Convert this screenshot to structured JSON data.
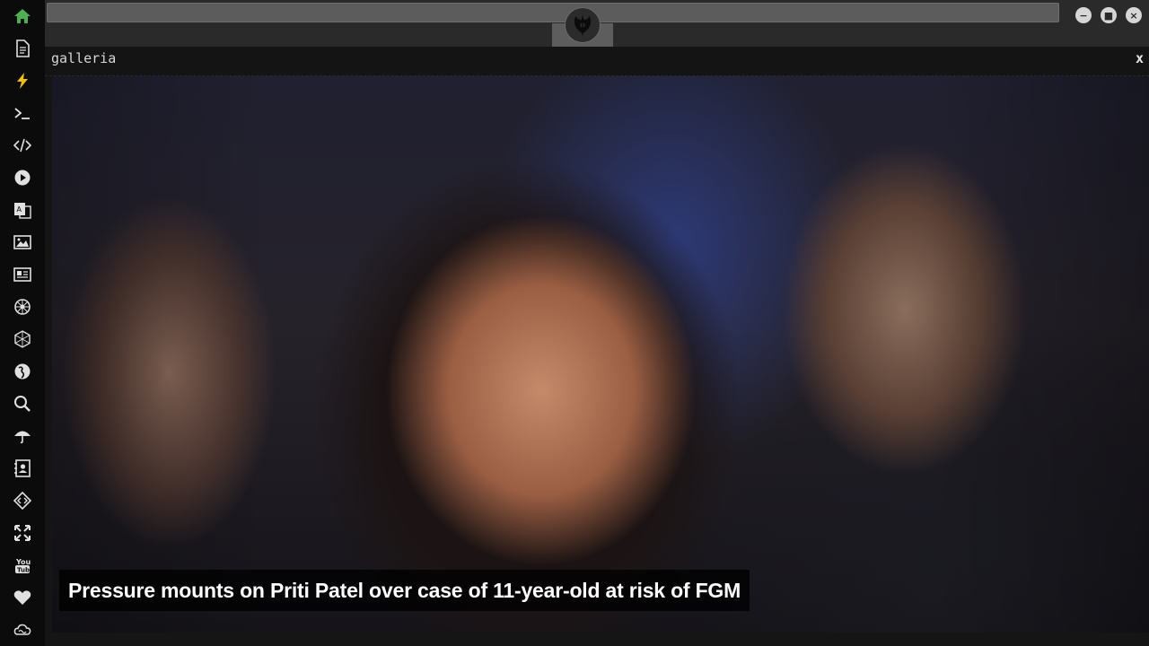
{
  "app": {
    "rebel_icon": "rebel-alliance-icon"
  },
  "dock": {
    "items": [
      {
        "name": "home",
        "icon": "home-icon",
        "color": "#4caf50"
      },
      {
        "name": "document",
        "icon": "document-icon",
        "color": "#e0e0e0"
      },
      {
        "name": "bolt",
        "icon": "bolt-icon",
        "color": "#f2c200"
      },
      {
        "name": "terminal",
        "icon": "terminal-icon",
        "color": "#e0e0e0"
      },
      {
        "name": "code",
        "icon": "code-icon",
        "color": "#e0e0e0"
      },
      {
        "name": "play",
        "icon": "play-icon",
        "color": "#e0e0e0"
      },
      {
        "name": "translate",
        "icon": "translate-icon",
        "color": "#e0e0e0"
      },
      {
        "name": "image",
        "icon": "image-icon",
        "color": "#e0e0e0"
      },
      {
        "name": "news",
        "icon": "newspaper-icon",
        "color": "#e0e0e0"
      },
      {
        "name": "network",
        "icon": "network-icon",
        "color": "#e0e0e0"
      },
      {
        "name": "cube",
        "icon": "hex-grid-icon",
        "color": "#e0e0e0"
      },
      {
        "name": "globe",
        "icon": "globe-icon",
        "color": "#e0e0e0"
      },
      {
        "name": "search",
        "icon": "search-icon",
        "color": "#e0e0e0"
      },
      {
        "name": "umbrella",
        "icon": "umbrella-icon",
        "color": "#e0e0e0"
      },
      {
        "name": "contacts",
        "icon": "contacts-icon",
        "color": "#e0e0e0"
      },
      {
        "name": "dev",
        "icon": "dev-icon",
        "color": "#e0e0e0"
      },
      {
        "name": "expand",
        "icon": "expand-icon",
        "color": "#e0e0e0"
      },
      {
        "name": "youtube",
        "icon": "youtube-icon",
        "color": "#e0e0e0"
      },
      {
        "name": "heart",
        "icon": "heart-icon",
        "color": "#e0e0e0"
      },
      {
        "name": "cloud",
        "icon": "cloud-icon",
        "color": "#e0e0e0"
      }
    ]
  },
  "window_controls": {
    "minimize": "−",
    "maximize": "■",
    "close": "×"
  },
  "panel": {
    "title": "galleria",
    "close_label": "x"
  },
  "gallery": {
    "caption": "Pressure mounts on Priti Patel over case of 11-year-old at risk of FGM"
  }
}
